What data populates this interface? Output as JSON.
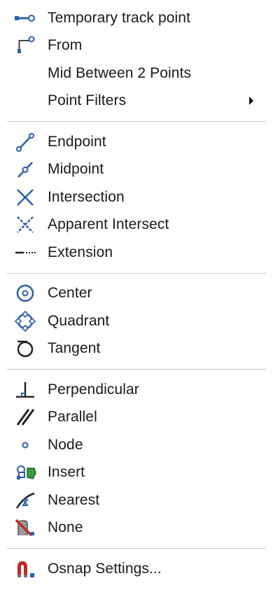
{
  "menu": {
    "items": [
      {
        "label": "Temporary track point",
        "icon": "temporary-track-point-icon"
      },
      {
        "label": "From",
        "icon": "from-icon"
      },
      {
        "label": "Mid Between 2 Points",
        "icon": ""
      },
      {
        "label": "Point Filters",
        "icon": "",
        "submenu": "chevron-right-icon"
      },
      {
        "label": "Endpoint",
        "icon": "endpoint-icon"
      },
      {
        "label": "Midpoint",
        "icon": "midpoint-icon"
      },
      {
        "label": "Intersection",
        "icon": "intersection-icon"
      },
      {
        "label": "Apparent Intersect",
        "icon": "apparent-intersect-icon"
      },
      {
        "label": "Extension",
        "icon": "extension-icon"
      },
      {
        "label": "Center",
        "icon": "center-icon"
      },
      {
        "label": "Quadrant",
        "icon": "quadrant-icon"
      },
      {
        "label": "Tangent",
        "icon": "tangent-icon"
      },
      {
        "label": "Perpendicular",
        "icon": "perpendicular-icon"
      },
      {
        "label": "Parallel",
        "icon": "parallel-icon"
      },
      {
        "label": "Node",
        "icon": "node-icon"
      },
      {
        "label": "Insert",
        "icon": "insert-icon"
      },
      {
        "label": "Nearest",
        "icon": "nearest-icon"
      },
      {
        "label": "None",
        "icon": "none-icon"
      },
      {
        "label": "Osnap Settings...",
        "icon": "osnap-settings-icon"
      }
    ]
  },
  "colors": {
    "icon_blue": "#2a5fb0",
    "icon_dark": "#222222",
    "icon_green": "#3c9a3c",
    "icon_red": "#c0282a",
    "separator": "#c8c8c8"
  }
}
